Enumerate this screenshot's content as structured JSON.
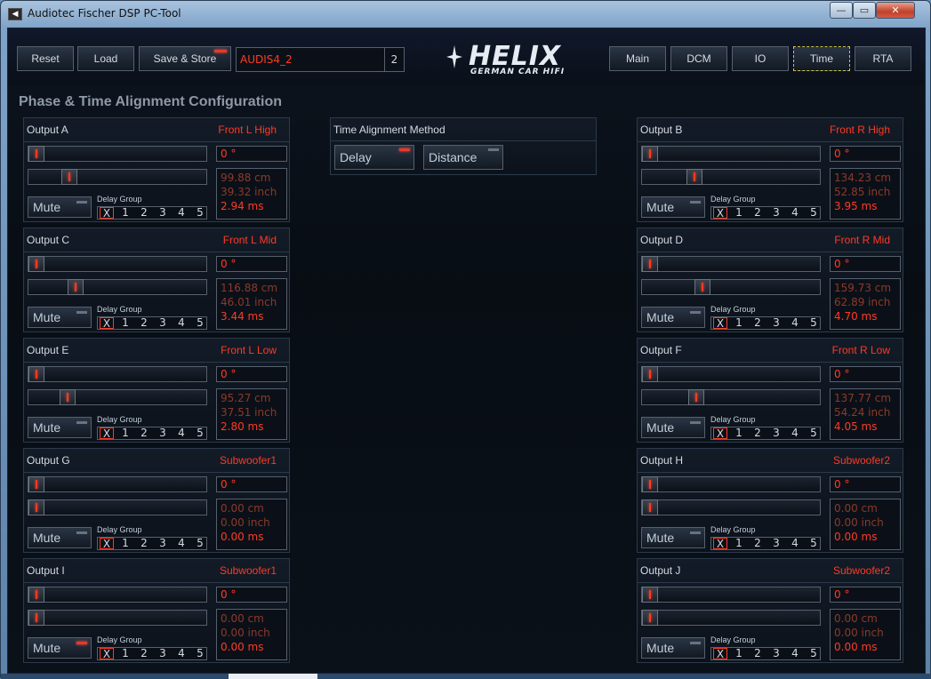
{
  "window": {
    "title": "Audiotec Fischer DSP PC-Tool",
    "min": "—",
    "max": "▭",
    "close": "✕"
  },
  "toolbar": {
    "reset": "Reset",
    "load": "Load",
    "save_store": "Save & Store",
    "preset_name": "AUDIS4_2",
    "preset_number": "2",
    "tabs": [
      "Main",
      "DCM",
      "IO",
      "Time",
      "RTA"
    ],
    "active_tab": "Time"
  },
  "logo": {
    "word": "HELIX",
    "tagline": "GERMAN CAR HIFI"
  },
  "section_title": "Phase & Time Alignment Configuration",
  "method": {
    "title": "Time Alignment Method",
    "delay": "Delay",
    "distance": "Distance",
    "selected": "Delay"
  },
  "delay_group_label": "Delay Group",
  "delay_group_options": [
    "X",
    "1",
    "2",
    "3",
    "4",
    "5"
  ],
  "mute_label": "Mute",
  "outputs": [
    {
      "id": "A",
      "title": "Output A",
      "channel": "Front L High",
      "phase": "0 °",
      "cm": "99.88 cm",
      "inch": "39.32 inch",
      "ms": "2.94 ms",
      "delay_fraction": 0.2,
      "mute_on": false
    },
    {
      "id": "B",
      "title": "Output B",
      "channel": "Front R High",
      "phase": "0 °",
      "cm": "134.23 cm",
      "inch": "52.85 inch",
      "ms": "3.95 ms",
      "delay_fraction": 0.27,
      "mute_on": false
    },
    {
      "id": "C",
      "title": "Output C",
      "channel": "Front L Mid",
      "phase": "0 °",
      "cm": "116.88 cm",
      "inch": "46.01 inch",
      "ms": "3.44 ms",
      "delay_fraction": 0.24,
      "mute_on": false
    },
    {
      "id": "D",
      "title": "Output D",
      "channel": "Front R Mid",
      "phase": "0 °",
      "cm": "159.73 cm",
      "inch": "62.89 inch",
      "ms": "4.70 ms",
      "delay_fraction": 0.32,
      "mute_on": false
    },
    {
      "id": "E",
      "title": "Output E",
      "channel": "Front L Low",
      "phase": "0 °",
      "cm": "95.27 cm",
      "inch": "37.51 inch",
      "ms": "2.80 ms",
      "delay_fraction": 0.19,
      "mute_on": false
    },
    {
      "id": "F",
      "title": "Output F",
      "channel": "Front R Low",
      "phase": "0 °",
      "cm": "137.77 cm",
      "inch": "54.24 inch",
      "ms": "4.05 ms",
      "delay_fraction": 0.28,
      "mute_on": false
    },
    {
      "id": "G",
      "title": "Output G",
      "channel": "Subwoofer1",
      "phase": "0 °",
      "cm": "0.00 cm",
      "inch": "0.00 inch",
      "ms": "0.00 ms",
      "delay_fraction": 0.0,
      "mute_on": false
    },
    {
      "id": "H",
      "title": "Output H",
      "channel": "Subwoofer2",
      "phase": "0 °",
      "cm": "0.00 cm",
      "inch": "0.00 inch",
      "ms": "0.00 ms",
      "delay_fraction": 0.0,
      "mute_on": false
    },
    {
      "id": "I",
      "title": "Output I",
      "channel": "Subwoofer1",
      "phase": "0 °",
      "cm": "0.00 cm",
      "inch": "0.00 inch",
      "ms": "0.00 ms",
      "delay_fraction": 0.0,
      "mute_on": true
    },
    {
      "id": "J",
      "title": "Output J",
      "channel": "Subwoofer2",
      "phase": "0 °",
      "cm": "0.00 cm",
      "inch": "0.00 inch",
      "ms": "0.00 ms",
      "delay_fraction": 0.0,
      "mute_on": false
    }
  ]
}
